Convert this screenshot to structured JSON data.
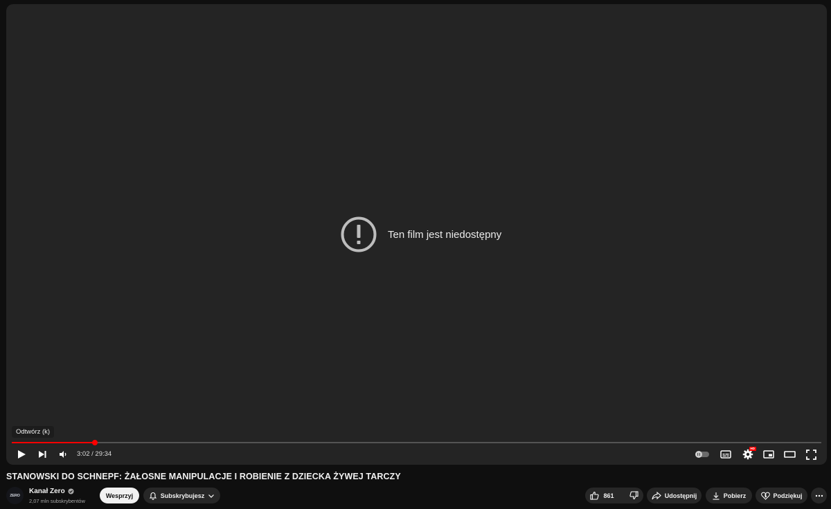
{
  "player": {
    "error_text": "Ten film jest niedostępny",
    "tooltip": "Odtwórz (k)",
    "progress_fraction": 0.1027,
    "time_current": "3:02",
    "time_separator": "/",
    "time_total": "29:34",
    "icons": [
      "play-icon",
      "next-icon",
      "volume-icon",
      "autoplay-toggle-icon",
      "subtitles-icon",
      "settings-icon",
      "miniplayer-icon",
      "theater-icon",
      "fullscreen-icon"
    ],
    "settings_badge": "HD"
  },
  "video": {
    "title": "STANOWSKI DO SCHNEPF: ŻAŁOSNE MANIPULACJE I ROBIENIE Z DZIECKA ŻYWEJ TARCZY"
  },
  "channel": {
    "avatar_text": "ZERO",
    "name": "Kanał Zero",
    "subscribers": "2,07 mln subskrybentów"
  },
  "actions": {
    "support_label": "Wesprzyj",
    "subscribed_label": "Subskrybujesz",
    "like_count": "861",
    "share_label": "Udostępnij",
    "download_label": "Pobierz",
    "thanks_label": "Podziękuj"
  },
  "colors": {
    "accent": "#ff0000",
    "player_bg": "#242424",
    "page_bg": "#0f0f0f",
    "pill_bg": "#272727"
  }
}
